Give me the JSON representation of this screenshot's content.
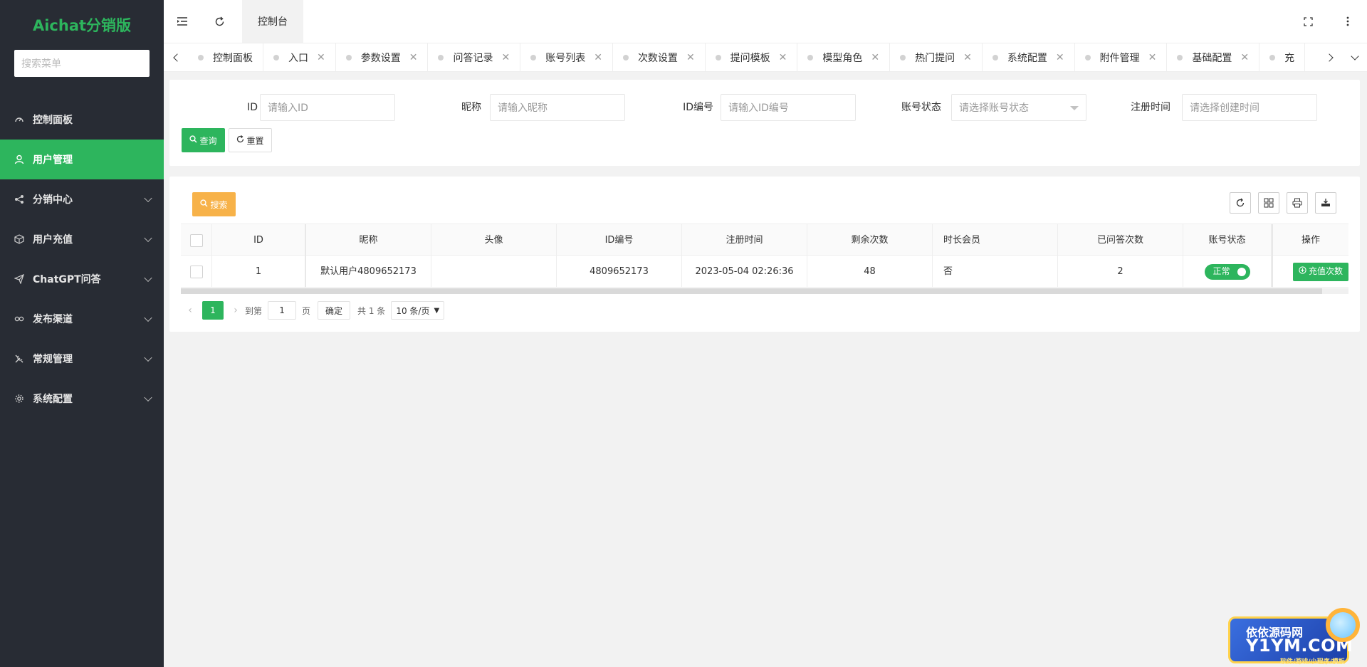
{
  "brand": {
    "title": "Aichat分销版",
    "color": "#2db55d"
  },
  "sidebar": {
    "search_placeholder": "搜索菜单",
    "items": [
      {
        "label": "控制面板",
        "icon": "dashboard-icon",
        "active": false,
        "expandable": false
      },
      {
        "label": "用户管理",
        "icon": "user-icon",
        "active": true,
        "expandable": false
      },
      {
        "label": "分销中心",
        "icon": "share-icon",
        "active": false,
        "expandable": true
      },
      {
        "label": "用户充值",
        "icon": "cube-icon",
        "active": false,
        "expandable": true
      },
      {
        "label": "ChatGPT问答",
        "icon": "send-icon",
        "active": false,
        "expandable": true
      },
      {
        "label": "发布渠道",
        "icon": "link-icon",
        "active": false,
        "expandable": true
      },
      {
        "label": "常规管理",
        "icon": "tools-icon",
        "active": false,
        "expandable": true
      },
      {
        "label": "系统配置",
        "icon": "gear-icon",
        "active": false,
        "expandable": true
      }
    ]
  },
  "topbar": {
    "home_tab": "控制台"
  },
  "tabs": [
    "控制面板",
    "入口",
    "参数设置",
    "问答记录",
    "账号列表",
    "次数设置",
    "提问模板",
    "模型角色",
    "热门提问",
    "系统配置",
    "附件管理",
    "基础配置",
    "充"
  ],
  "query": {
    "fields": [
      {
        "label": "ID",
        "placeholder": "请输入ID"
      },
      {
        "label": "昵称",
        "placeholder": "请输入昵称"
      },
      {
        "label": "ID编号",
        "placeholder": "请输入ID编号"
      },
      {
        "label": "账号状态",
        "placeholder": "请选择账号状态"
      },
      {
        "label": "注册时间",
        "placeholder": "请选择创建时间"
      }
    ],
    "submit_label": "查询",
    "reset_label": "重置"
  },
  "table": {
    "search_label": "搜索",
    "headers": [
      "ID",
      "昵称",
      "头像",
      "ID编号",
      "注册时间",
      "剩余次数",
      "时长会员",
      "已问答次数",
      "账号状态",
      "操作"
    ],
    "rows": [
      {
        "id": "1",
        "nickname": "默认用户4809652173",
        "avatar": "",
        "id_no": "4809652173",
        "reg_time": "2023-05-04 02:26:36",
        "remaining": "48",
        "member": "否",
        "answered": "2",
        "status": "正常",
        "action": "充值次数"
      }
    ]
  },
  "pager": {
    "current": "1",
    "goto_label": "到第",
    "page_value": "1",
    "page_unit": "页",
    "confirm": "确定",
    "total": "共 1 条",
    "page_size": "10 条/页"
  },
  "watermark": {
    "line1": "依依源码网",
    "line2": "Y1YM.COM",
    "line3": "软件/游戏/小程序/模板"
  }
}
